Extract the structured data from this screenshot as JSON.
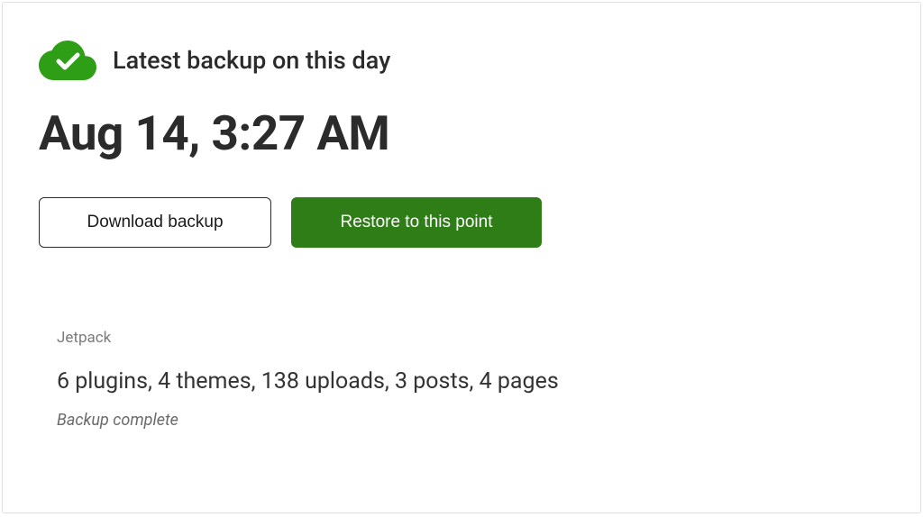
{
  "header": {
    "title": "Latest backup on this day"
  },
  "timestamp": "Aug 14, 3:27 AM",
  "buttons": {
    "download": "Download backup",
    "restore": "Restore to this point"
  },
  "details": {
    "source": "Jetpack",
    "summary": "6 plugins, 4 themes, 138 uploads, 3 posts, 4 pages",
    "status": "Backup complete"
  },
  "colors": {
    "accent": "#2e7d17"
  }
}
